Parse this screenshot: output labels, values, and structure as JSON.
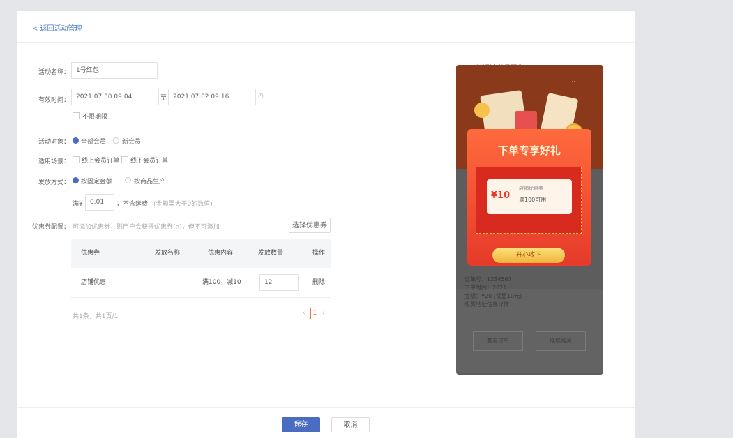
{
  "header": {
    "back_label": "< 返回活动管理"
  },
  "form": {
    "name_label": "活动名称：",
    "name_value": "1号红包",
    "time_label": "有效时间：",
    "start_time": "2021.07.30 09:04",
    "to_label": "至",
    "end_time": "2021.07.02 09:16",
    "long_term_label": "不限期限",
    "target_label": "活动对象：",
    "target_options": [
      "全部会员",
      "新会员"
    ],
    "scope_label": "适用场景：",
    "scope_options": [
      "线上会员订单",
      "线下会员订单"
    ],
    "rule_label": "发放方式：",
    "rule_options": [
      "按固定金额",
      "按商品生产"
    ],
    "amount_prefix": "满¥",
    "amount_value": "0.01",
    "amount_suffix": "，不含运费",
    "amount_hint": "(金额需大于0的数值)",
    "coupon_label": "优惠券配置：",
    "coupon_hint": "可添加优惠券，则用户会获得优惠券(n)，但不可添加",
    "add_coupon_button": "选择优惠券"
  },
  "table": {
    "headers": [
      "优惠券",
      "发放名称",
      "优惠内容",
      "发放数量",
      "操作"
    ],
    "rows": [
      {
        "name": "店铺优惠",
        "content": "满100，减10",
        "quantity": "12",
        "action": "删除"
      }
    ],
    "footer_text": "共1条，共1页/1",
    "page": "1"
  },
  "preview": {
    "title": "活动弹窗效果预览：",
    "popup_title": "下单专享好礼",
    "coupon_amount": "¥10",
    "coupon_type": "店铺优惠券",
    "coupon_text": "满100可用",
    "popup_button": "开心收下",
    "bg_lines": [
      "订单号：1234567",
      "下单时间：2021",
      "金额：¥20 (优惠10元)",
      "收货地址信息详情"
    ],
    "bg_buttons": [
      "查看订单",
      "继续购买"
    ]
  },
  "footer": {
    "save_label": "保存",
    "cancel_label": "取消"
  },
  "colors": {
    "primary": "#4a6dc2",
    "popup_red": "#e63a2a",
    "popup_gold": "#f5c24b"
  }
}
